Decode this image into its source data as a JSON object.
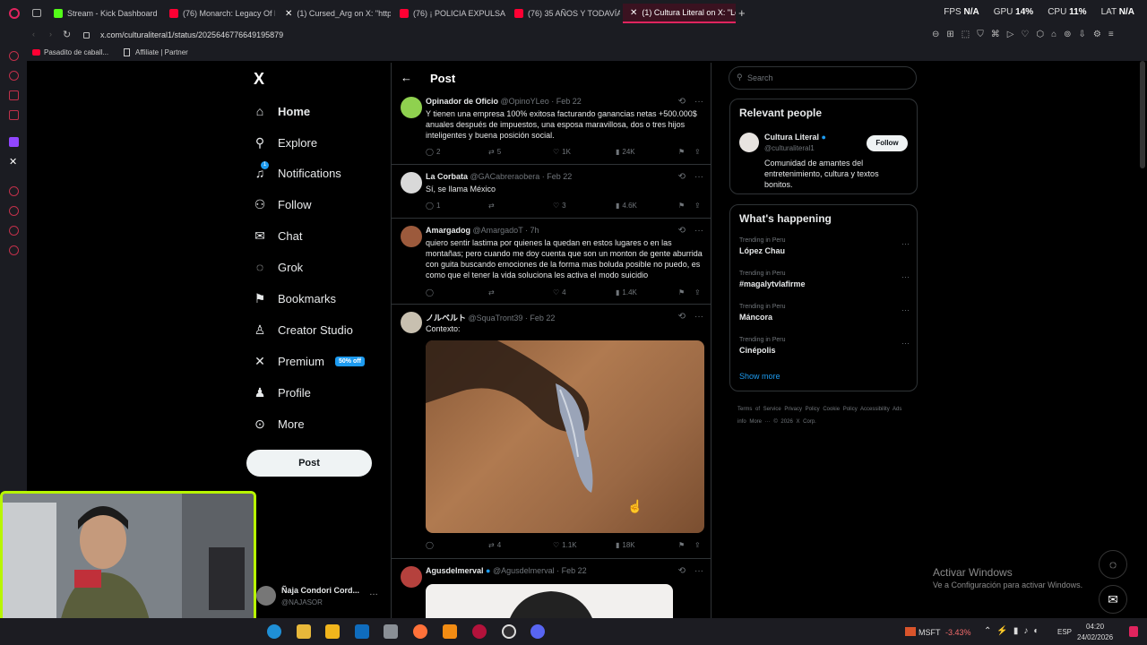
{
  "browser": {
    "tabs": [
      {
        "label": "Stream - Kick Dashboard",
        "color": "#53fc18"
      },
      {
        "label": "(76) Monarch: Legacy Of M",
        "color": "#ff0033"
      },
      {
        "label": "(1) Cursed_Arg on X: \"http",
        "color": "#cccccc"
      },
      {
        "label": "(76) ¡ POLICIA EXPULSA A",
        "color": "#ff0033"
      },
      {
        "label": "(76) 35 AÑOS Y TODAVÍA",
        "color": "#ff0033"
      },
      {
        "label": "(1) Cultura Literal on X: \"Lo",
        "color": "#cccccc"
      }
    ],
    "new_tab": "+",
    "stats": {
      "fps_label": "FPS",
      "fps": "N/A",
      "gpu_label": "GPU",
      "gpu": "14%",
      "cpu_label": "CPU",
      "cpu": "11%",
      "lat_label": "LAT",
      "lat": "N/A"
    },
    "url": "x.com/culturaliteral1/status/2025646776649195879",
    "bookmarks": [
      {
        "label": "Pasadito de caball...",
        "color": "#ff0033"
      },
      {
        "label": "Affiliate | Partner",
        "color": "#cccccc"
      }
    ]
  },
  "x_nav": {
    "logo": "X",
    "items": [
      {
        "label": "Home",
        "icon": "home-icon",
        "glyph": "⌂"
      },
      {
        "label": "Explore",
        "icon": "search-icon",
        "glyph": "⚲"
      },
      {
        "label": "Notifications",
        "icon": "bell-icon",
        "glyph": "♫"
      },
      {
        "label": "Follow",
        "icon": "follow-icon",
        "glyph": "⚇"
      },
      {
        "label": "Chat",
        "icon": "mail-icon",
        "glyph": "✉"
      },
      {
        "label": "Grok",
        "icon": "grok-icon",
        "glyph": "◌"
      },
      {
        "label": "Bookmarks",
        "icon": "bookmark-icon",
        "glyph": "⚑"
      },
      {
        "label": "Creator Studio",
        "icon": "creator-icon",
        "glyph": "♙"
      },
      {
        "label": "Premium",
        "icon": "x-premium-icon",
        "glyph": "✕"
      },
      {
        "label": "Profile",
        "icon": "profile-icon",
        "glyph": "♟"
      },
      {
        "label": "More",
        "icon": "more-icon",
        "glyph": "⊙"
      }
    ],
    "premium_badge": "50% off",
    "notifications_dot": "1",
    "post_button": "Post",
    "account": {
      "name": "Ñaja Condori Cord...",
      "handle": "@NAJASOR",
      "more": "…"
    }
  },
  "timeline": {
    "header": "Post",
    "back": "←",
    "tweets": [
      {
        "name": "Opinador de Oficio",
        "handle": "@OpinoYLeo",
        "time": "Feb 22",
        "text": "Y tienen una empresa 100% exitosa facturando ganancias netas +500.000$ anuales después de impuestos, una esposa maravillosa, dos o tres hijos inteligentes y buena posición social.",
        "replies": "2",
        "retweets": "5",
        "likes": "1K",
        "views": "24K",
        "avatar": "#8fd14f"
      },
      {
        "name": "La Corbata",
        "handle": "@GACabreraobera",
        "time": "Feb 22",
        "text": "Sí, se llama México",
        "replies": "1",
        "retweets": "",
        "likes": "3",
        "views": "4.6K",
        "avatar": "#d9d9d9"
      },
      {
        "name": "Amargadog",
        "handle": "@AmargadoT",
        "time": "7h",
        "text": "quiero sentir lastima por quienes la quedan en estos lugares o en las montañas; pero cuando me doy cuenta que son un monton de gente aburrida con guita buscando emociones de la forma mas boluda posible no puedo, es como que el tener la vida soluciona les activa el modo suicidio",
        "replies": "",
        "retweets": "",
        "likes": "4",
        "views": "1.4K",
        "avatar": "#9c5a3c"
      },
      {
        "name": "ノルベルト",
        "handle": "@SquaTront39",
        "time": "Feb 22",
        "text": "Contexto:",
        "replies": "",
        "retweets": "4",
        "likes": "1.1K",
        "views": "18K",
        "avatar": "#c8c0b0"
      },
      {
        "name": "Agusdelmerval",
        "handle": "@Agusdelmerval",
        "time": "Feb 22",
        "text": "",
        "replies": "",
        "retweets": "",
        "likes": "",
        "views": "",
        "avatar": "#b5413d"
      }
    ]
  },
  "sidebar": {
    "search_placeholder": "Search",
    "relevant_title": "Relevant people",
    "person": {
      "name": "Cultura Literal",
      "handle": "@culturaliteral1",
      "bio": "Comunidad de amantes del entretenimiento, cultura y textos bonitos.",
      "follow": "Follow"
    },
    "happening_title": "What's happening",
    "trends": [
      {
        "label": "Trending in Peru",
        "topic": "López Chau"
      },
      {
        "label": "Trending in Peru",
        "topic": "#magalytvlafirme"
      },
      {
        "label": "Trending in Peru",
        "topic": "Máncora"
      },
      {
        "label": "Trending in Peru",
        "topic": "Cinépolis"
      }
    ],
    "show_more": "Show more",
    "footer": "Terms of Service   Privacy Policy   Cookie Policy   Accessibility   Ads info   More ···   © 2026 X Corp."
  },
  "watermark": {
    "line1": "Activar Windows",
    "line2": "Ve a Configuración para activar Windows."
  },
  "taskbar": {
    "stock": "MSFT",
    "change": "-3.43%",
    "lang": "ESP",
    "time": "04:20",
    "date": "24/02/2026"
  }
}
